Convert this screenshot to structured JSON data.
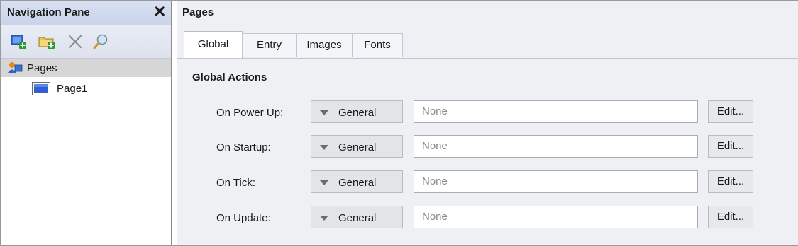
{
  "nav_pane": {
    "title": "Navigation Pane",
    "close_glyph": "✕",
    "toolbar": [
      {
        "icon": "add-page-icon"
      },
      {
        "icon": "add-folder-icon"
      },
      {
        "icon": "delete-icon"
      },
      {
        "icon": "find-icon"
      }
    ],
    "tree": {
      "root_label": "Pages",
      "root_icon": "pages-group-icon",
      "children": [
        {
          "label": "Page1",
          "icon": "page-icon"
        }
      ]
    }
  },
  "main": {
    "title": "Pages",
    "tabs": [
      {
        "label": "Global",
        "active": true
      },
      {
        "label": "Entry",
        "active": false
      },
      {
        "label": "Images",
        "active": false
      },
      {
        "label": "Fonts",
        "active": false
      }
    ],
    "section_title": "Global Actions",
    "rows": [
      {
        "label": "On Power Up:",
        "dropdown": "General",
        "value": "None",
        "button": "Edit..."
      },
      {
        "label": "On Startup:",
        "dropdown": "General",
        "value": "None",
        "button": "Edit..."
      },
      {
        "label": "On Tick:",
        "dropdown": "General",
        "value": "None",
        "button": "Edit..."
      },
      {
        "label": "On Update:",
        "dropdown": "General",
        "value": "None",
        "button": "Edit..."
      }
    ]
  },
  "colors": {
    "nav_header": "#c9d4ea",
    "panel_background": "#eef0f4",
    "tree_selection": "#d6d6d6"
  }
}
